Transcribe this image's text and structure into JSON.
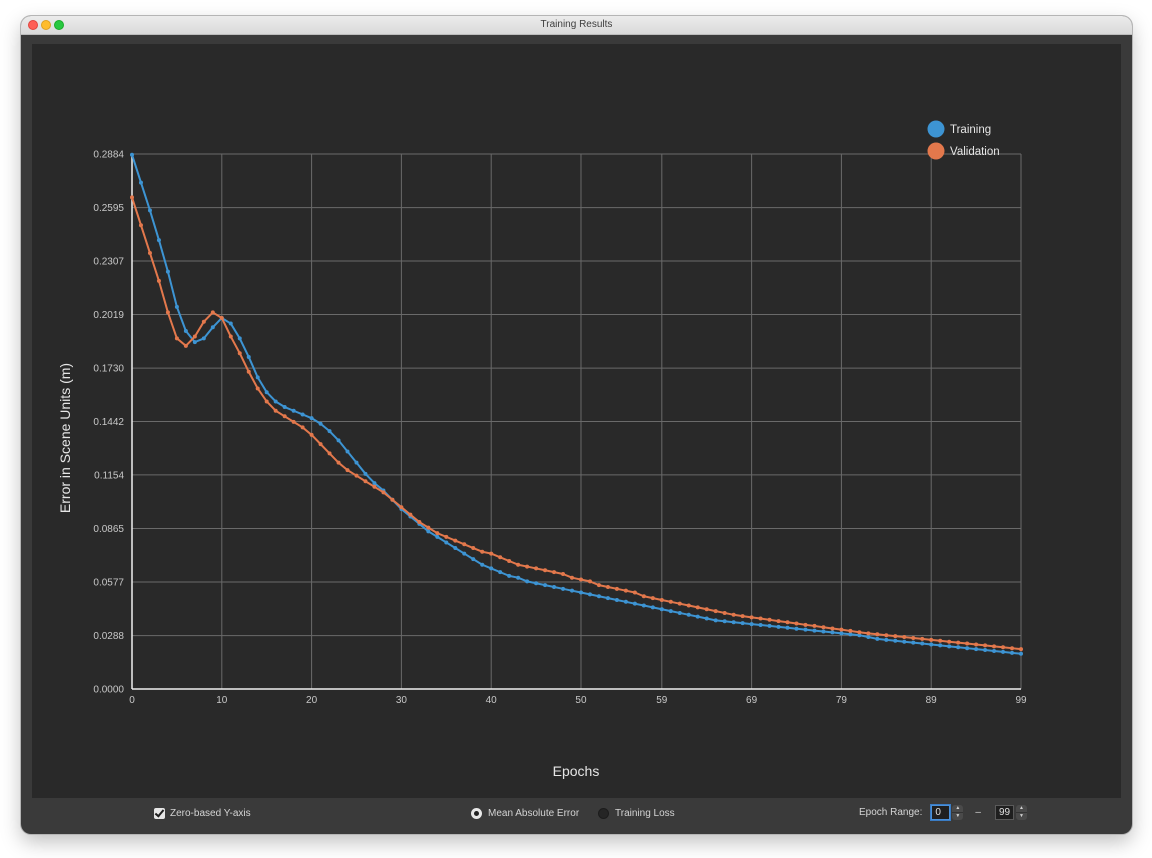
{
  "window": {
    "title": "Training Results"
  },
  "legend": {
    "training_label": "Training",
    "validation_label": "Validation"
  },
  "controls": {
    "zero_based_label": "Zero-based Y-axis",
    "zero_based_checked": true,
    "metric_options": [
      "Mean Absolute Error",
      "Training Loss"
    ],
    "metric_selected": "Mean Absolute Error",
    "epoch_range_label": "Epoch Range:",
    "epoch_range_separator": "–",
    "epoch_start": "0",
    "epoch_end": "99"
  },
  "colors": {
    "training": "#3d94d3",
    "validation": "#e3784c",
    "background": "#292929",
    "grid": "#6a6a6a"
  },
  "chart_data": {
    "type": "line",
    "xlabel": "Epochs",
    "ylabel": "Error in Scene Units (m)",
    "xlim": [
      0,
      99
    ],
    "ylim": [
      0,
      0.2884
    ],
    "x_ticks": [
      0,
      10,
      20,
      30,
      40,
      50,
      59,
      69,
      79,
      89,
      99
    ],
    "y_ticks": [
      "0.0000",
      "0.0288",
      "0.0577",
      "0.0865",
      "0.1154",
      "0.1442",
      "0.1730",
      "0.2019",
      "0.2307",
      "0.2595",
      "0.2884"
    ],
    "grid": true,
    "legend_position": "top-right",
    "series": [
      {
        "name": "Training",
        "values": [
          0.288,
          0.273,
          0.258,
          0.242,
          0.225,
          0.206,
          0.193,
          0.187,
          0.189,
          0.195,
          0.2,
          0.197,
          0.189,
          0.179,
          0.168,
          0.16,
          0.155,
          0.152,
          0.15,
          0.148,
          0.146,
          0.143,
          0.139,
          0.134,
          0.128,
          0.122,
          0.116,
          0.111,
          0.107,
          0.102,
          0.097,
          0.093,
          0.089,
          0.085,
          0.082,
          0.079,
          0.076,
          0.073,
          0.07,
          0.067,
          0.065,
          0.063,
          0.061,
          0.06,
          0.058,
          0.057,
          0.056,
          0.055,
          0.054,
          0.053,
          0.052,
          0.051,
          0.05,
          0.049,
          0.048,
          0.047,
          0.046,
          0.045,
          0.044,
          0.043,
          0.042,
          0.041,
          0.04,
          0.039,
          0.038,
          0.037,
          0.0365,
          0.036,
          0.0355,
          0.035,
          0.0345,
          0.034,
          0.0335,
          0.033,
          0.0325,
          0.032,
          0.0315,
          0.031,
          0.0305,
          0.03,
          0.0295,
          0.029,
          0.028,
          0.027,
          0.0265,
          0.026,
          0.0255,
          0.025,
          0.0245,
          0.024,
          0.0235,
          0.023,
          0.0225,
          0.022,
          0.0215,
          0.021,
          0.0205,
          0.02,
          0.0195,
          0.019
        ]
      },
      {
        "name": "Validation",
        "values": [
          0.265,
          0.25,
          0.235,
          0.22,
          0.203,
          0.189,
          0.185,
          0.19,
          0.198,
          0.203,
          0.2,
          0.19,
          0.181,
          0.171,
          0.162,
          0.155,
          0.15,
          0.147,
          0.144,
          0.141,
          0.137,
          0.132,
          0.127,
          0.122,
          0.118,
          0.115,
          0.112,
          0.109,
          0.106,
          0.102,
          0.098,
          0.094,
          0.09,
          0.087,
          0.084,
          0.082,
          0.08,
          0.078,
          0.076,
          0.074,
          0.073,
          0.071,
          0.069,
          0.067,
          0.066,
          0.065,
          0.064,
          0.063,
          0.062,
          0.06,
          0.059,
          0.058,
          0.056,
          0.055,
          0.054,
          0.053,
          0.052,
          0.05,
          0.049,
          0.048,
          0.047,
          0.046,
          0.045,
          0.044,
          0.043,
          0.042,
          0.041,
          0.04,
          0.0393,
          0.0386,
          0.038,
          0.0373,
          0.0366,
          0.036,
          0.0353,
          0.0346,
          0.034,
          0.0333,
          0.0326,
          0.032,
          0.0313,
          0.0306,
          0.03,
          0.0295,
          0.029,
          0.0285,
          0.028,
          0.0275,
          0.027,
          0.0265,
          0.026,
          0.0255,
          0.025,
          0.0245,
          0.024,
          0.0235,
          0.023,
          0.0225,
          0.022,
          0.0215
        ]
      }
    ]
  }
}
